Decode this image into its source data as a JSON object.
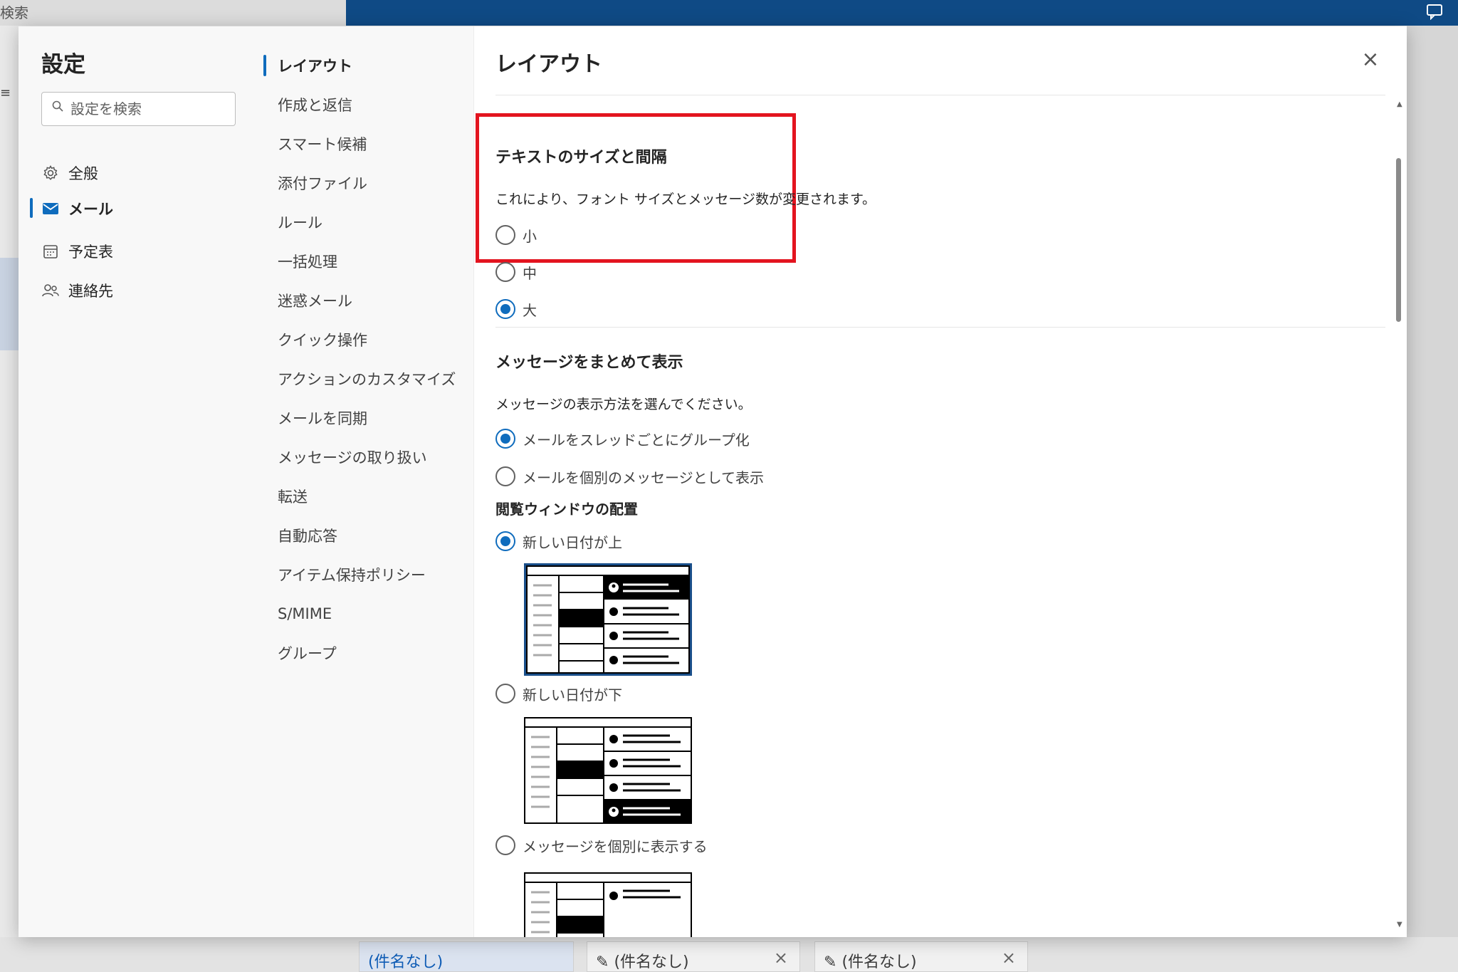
{
  "background": {
    "search_label": "検索",
    "tabs": [
      {
        "label": "(件名なし)",
        "active": true
      },
      {
        "label": "(件名なし)",
        "active": false
      },
      {
        "label": "(件名なし)",
        "active": false
      }
    ],
    "tab_close": "×"
  },
  "settings": {
    "title": "設定",
    "search_placeholder": "設定を検索",
    "categories": [
      {
        "label": "全般",
        "icon": "gear-icon"
      },
      {
        "label": "メール",
        "icon": "mail-icon",
        "active": true
      },
      {
        "label": "予定表",
        "icon": "calendar-icon"
      },
      {
        "label": "連絡先",
        "icon": "people-icon"
      }
    ],
    "subcategories": [
      "レイアウト",
      "作成と返信",
      "スマート候補",
      "添付ファイル",
      "ルール",
      "一括処理",
      "迷惑メール",
      "クイック操作",
      "アクションのカスタマイズ",
      "メールを同期",
      "メッセージの取り扱い",
      "転送",
      "自動応答",
      "アイテム保持ポリシー",
      "S/MIME",
      "グループ"
    ]
  },
  "content": {
    "title": "レイアウト",
    "close_label": "×",
    "text_size": {
      "title": "テキストのサイズと間隔",
      "description": "これにより、フォント サイズとメッセージ数が変更されます。",
      "options": [
        "小",
        "中",
        "大"
      ],
      "selected": "大"
    },
    "conversation": {
      "title": "メッセージをまとめて表示",
      "description": "メッセージの表示方法を選んでください。",
      "options": [
        "メールをスレッドごとにグループ化",
        "メールを個別のメッセージとして表示"
      ],
      "selected": "メールをスレッドごとにグループ化"
    },
    "reading_pane": {
      "title": "閲覧ウィンドウの配置",
      "options": [
        "新しい日付が上",
        "新しい日付が下",
        "メッセージを個別に表示する"
      ],
      "selected": "新しい日付が上"
    }
  },
  "colors": {
    "accent": "#0f6cbd",
    "highlight": "#e3141f",
    "topbar": "#0f4a85"
  }
}
